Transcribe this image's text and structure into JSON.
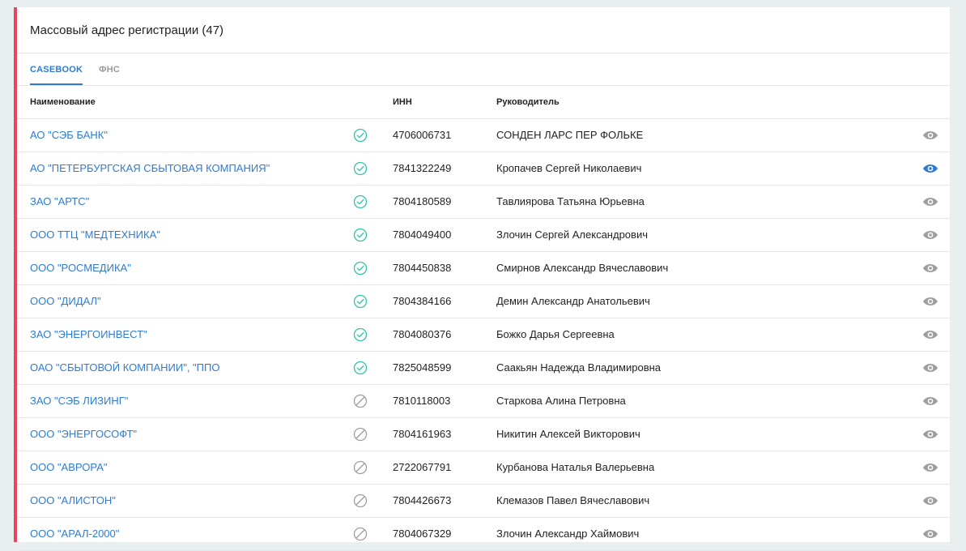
{
  "panel": {
    "title": "Массовый адрес регистрации (47)"
  },
  "tabs": [
    {
      "label": "CASEBOOK",
      "active": true
    },
    {
      "label": "ФНС",
      "active": false
    }
  ],
  "columns": {
    "name": "Наименование",
    "inn": "ИНН",
    "head": "Руководитель"
  },
  "colors": {
    "accent": "#2f7bd1",
    "left_border": "#e8435f",
    "status_active": "#2ec4a6",
    "status_inactive": "#9e9e9e",
    "eye_default": "#9e9e9e",
    "eye_highlight": "#2f7bd1"
  },
  "rows": [
    {
      "name": "АО \"СЭБ БАНК\"",
      "status": "active",
      "inn": "4706006731",
      "head": "СОНДЕН ЛАРС ПЕР ФОЛЬКЕ",
      "eye": "default"
    },
    {
      "name": "АО \"ПЕТЕРБУРГСКАЯ СБЫТОВАЯ КОМПАНИЯ\"",
      "status": "active",
      "inn": "7841322249",
      "head": "Кропачев Сергей Николаевич",
      "eye": "highlight"
    },
    {
      "name": "ЗАО \"АРТС\"",
      "status": "active",
      "inn": "7804180589",
      "head": "Тавлиярова Татьяна Юрьевна",
      "eye": "default"
    },
    {
      "name": "ООО ТТЦ \"МЕДТЕХНИКА\"",
      "status": "active",
      "inn": "7804049400",
      "head": "Злочин Сергей Александрович",
      "eye": "default"
    },
    {
      "name": "ООО \"РОСМЕДИКА\"",
      "status": "active",
      "inn": "7804450838",
      "head": "Смирнов Александр Вячеславович",
      "eye": "default"
    },
    {
      "name": "ООО \"ДИДАЛ\"",
      "status": "active",
      "inn": "7804384166",
      "head": "Демин Александр Анатольевич",
      "eye": "default"
    },
    {
      "name": "ЗАО \"ЭНЕРГОИНВЕСТ\"",
      "status": "active",
      "inn": "7804080376",
      "head": "Божко Дарья Сергеевна",
      "eye": "default"
    },
    {
      "name": "ОАО \"СБЫТОВОЙ КОМПАНИИ\", \"ППО",
      "status": "active",
      "inn": "7825048599",
      "head": "Саакьян Надежда Владимировна",
      "eye": "default"
    },
    {
      "name": "ЗАО \"СЭБ ЛИЗИНГ\"",
      "status": "inactive",
      "inn": "7810118003",
      "head": "Старкова Алина Петровна",
      "eye": "default"
    },
    {
      "name": "ООО \"ЭНЕРГОСОФТ\"",
      "status": "inactive",
      "inn": "7804161963",
      "head": "Никитин Алексей Викторович",
      "eye": "default"
    },
    {
      "name": "ООО \"АВРОРА\"",
      "status": "inactive",
      "inn": "2722067791",
      "head": "Курбанова Наталья Валерьевна",
      "eye": "default"
    },
    {
      "name": "ООО \"АЛИСТОН\"",
      "status": "inactive",
      "inn": "7804426673",
      "head": "Клемазов Павел Вячеславович",
      "eye": "default"
    },
    {
      "name": "ООО \"АРАЛ-2000\"",
      "status": "inactive",
      "inn": "7804067329",
      "head": "Злочин Александр Хаймович",
      "eye": "default"
    }
  ]
}
